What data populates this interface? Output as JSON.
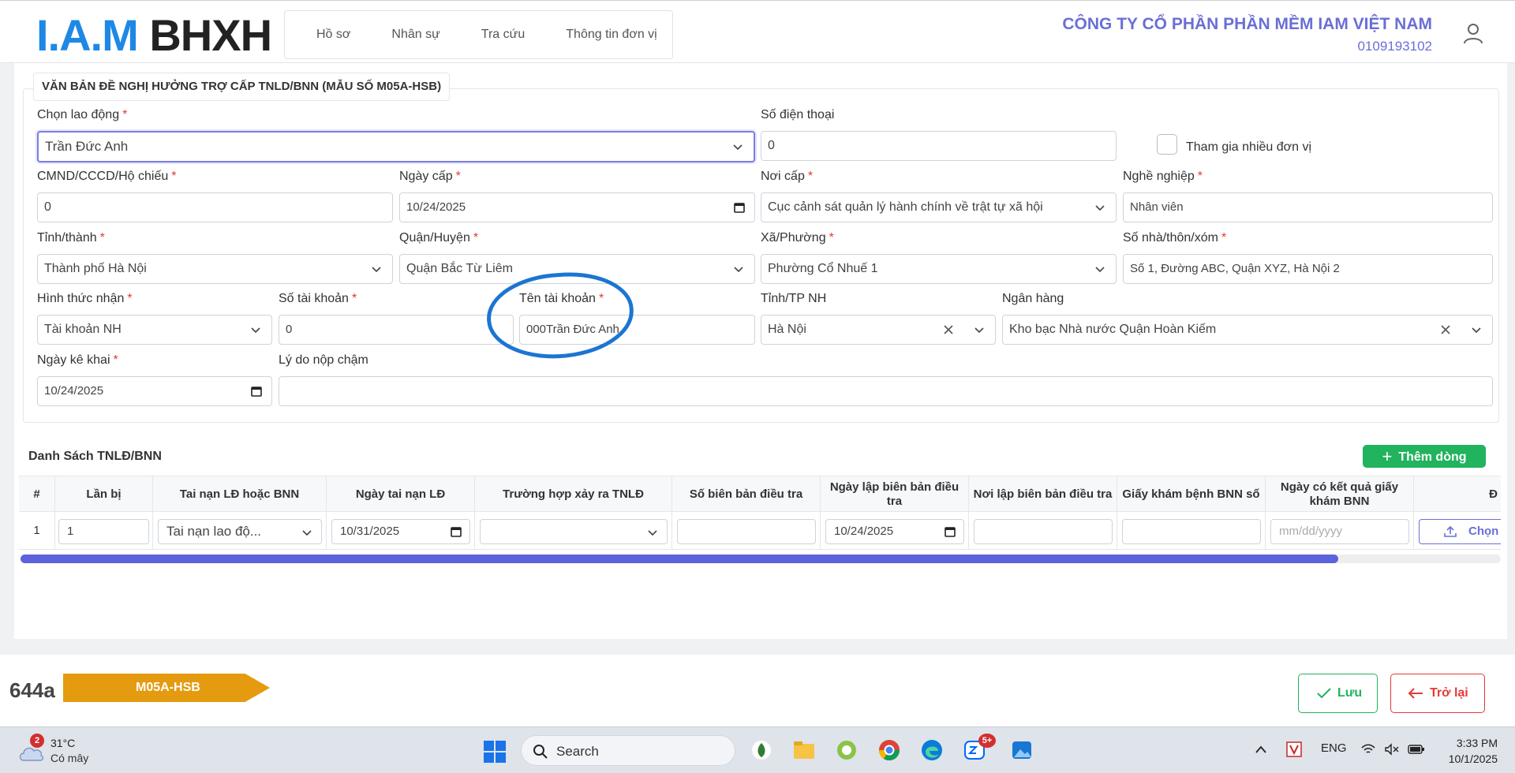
{
  "header": {
    "logo_part1": "I.A.M",
    "logo_part2": "BHXH",
    "nav": [
      "Hồ sơ",
      "Nhân sự",
      "Tra cứu",
      "Thông tin đơn vị"
    ],
    "company_name": "CÔNG TY CỔ PHẦN PHẦN MỀM IAM VIỆT NAM",
    "tax_code": "0109193102"
  },
  "form": {
    "legend": "VĂN BẢN ĐỀ NGHỊ HƯỞNG TRỢ CẤP TNLD/BNN (MẪU SỐ M05A-HSB)",
    "employee_label": "Chọn lao động",
    "employee_value": "Trần Đức Anh",
    "phone_label": "Số điện thoại",
    "phone_value": "0",
    "multi_unit_label": "Tham gia nhiều đơn vị",
    "id_label": "CMND/CCCD/Hộ chiếu",
    "id_value": "0",
    "issue_date_label": "Ngày cấp",
    "issue_date_value": "10/24/2025",
    "issue_place_label": "Nơi cấp",
    "issue_place_value": "Cục cảnh sát quản lý hành chính về trật tự xã hội",
    "job_label": "Nghề nghiệp",
    "job_value": "Nhân viên",
    "province_label": "Tỉnh/thành",
    "province_value": "Thành phố Hà Nội",
    "district_label": "Quận/Huyện",
    "district_value": "Quận Bắc Từ Liêm",
    "ward_label": "Xã/Phường",
    "ward_value": "Phường Cổ Nhuế 1",
    "address_label": "Số nhà/thôn/xóm",
    "address_value": "Số 1, Đường ABC, Quận XYZ, Hà Nội 2",
    "receive_label": "Hình thức nhận",
    "receive_value": "Tài khoản NH",
    "account_no_label": "Số tài khoản",
    "account_no_value": "0",
    "account_name_label": "Tên tài khoản",
    "account_name_value": "000Trần Đức Anh",
    "bank_province_label": "Tỉnh/TP NH",
    "bank_province_value": "Hà Nội",
    "bank_label": "Ngân hàng",
    "bank_value": "Kho bạc Nhà nước Quận Hoàn Kiếm",
    "declare_date_label": "Ngày kê khai",
    "declare_date_value": "10/24/2025",
    "late_reason_label": "Lý do nộp chậm",
    "late_reason_value": ""
  },
  "table": {
    "title": "Danh Sách TNLĐ/BNN",
    "add_button": "Thêm dòng",
    "columns": [
      "#",
      "Lần bị",
      "Tai nạn LĐ hoặc BNN",
      "Ngày tai nạn LĐ",
      "Trường hợp xảy ra TNLĐ",
      "Số biên bản điều tra",
      "Ngày lập biên bản điều tra",
      "Nơi lập biên bản điều tra",
      "Giấy khám bệnh BNN số",
      "Ngày có kết quả giấy khám BNN",
      "Đ"
    ],
    "rows": [
      {
        "index": "1",
        "times": "1",
        "type": "Tai nạn lao độ...",
        "accident_date": "10/31/2025",
        "case": "",
        "report_no": "",
        "report_date": "10/24/2025",
        "report_place": "",
        "bnn_no": "",
        "result_date_placeholder": "mm/dd/yyyy",
        "choose_label": "Chọn"
      }
    ],
    "scroll_fraction": 0.89
  },
  "footer": {
    "code": "644a",
    "form_tag": "M05A-HSB",
    "save_label": "Lưu",
    "back_label": "Trở lại"
  },
  "taskbar": {
    "weather_badge": "2",
    "temperature": "31°C",
    "weather_desc": "Có mây",
    "search_label": "Search",
    "zalo_badge": "5+",
    "language": "ENG",
    "time": "3:33 PM",
    "date": "10/1/2025"
  },
  "colors": {
    "accent": "#6a6fd6",
    "logo_blue": "#1e88e5",
    "success": "#21b35d",
    "danger": "#e53935",
    "tag_orange": "#e49b0f",
    "annotation_circle": "#1c75d1"
  }
}
